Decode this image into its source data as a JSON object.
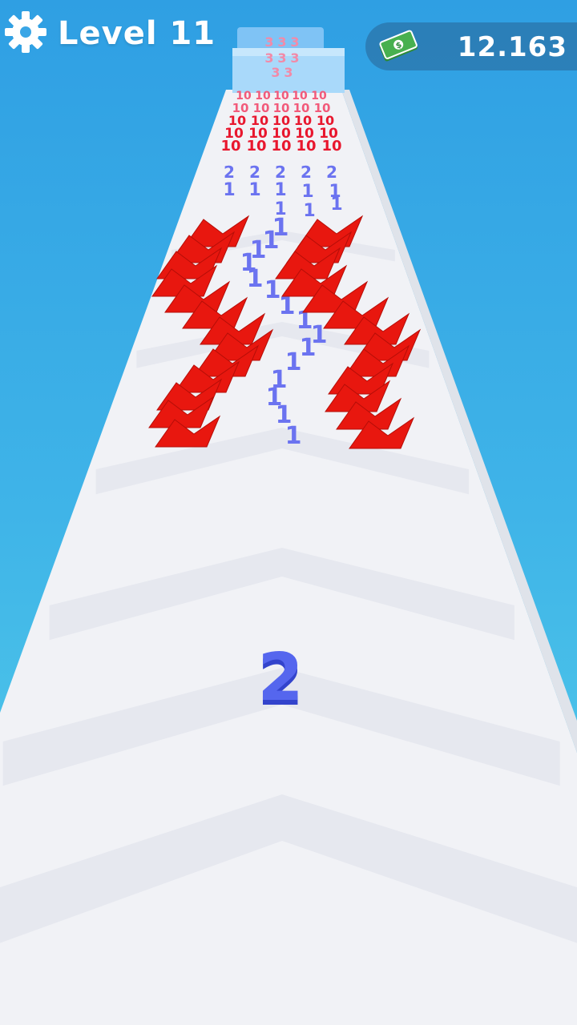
{
  "hud": {
    "level_label": "Level 11",
    "currency_value": "12.163",
    "settings_icon": "gear-icon",
    "currency_icon": "cash-bill-icon"
  },
  "player": {
    "value": "2",
    "color": "#4a5ce6"
  },
  "board": {
    "front_rows": [
      {
        "label": "2",
        "color": "#6b73f0"
      },
      {
        "label": "1",
        "color": "#6b73f0"
      },
      {
        "label": "1",
        "color": "#6b73f0"
      }
    ],
    "blue_number": "1",
    "enemy_number": "10",
    "far_block_number": "3"
  },
  "colors": {
    "sky_top": "#2f9fe3",
    "sky_bottom": "#57d2ea",
    "track": "#f1f2f6",
    "obstacle": "#e8170f",
    "enemy": "#ee2a4a",
    "blue_unit": "#6b73f0"
  }
}
